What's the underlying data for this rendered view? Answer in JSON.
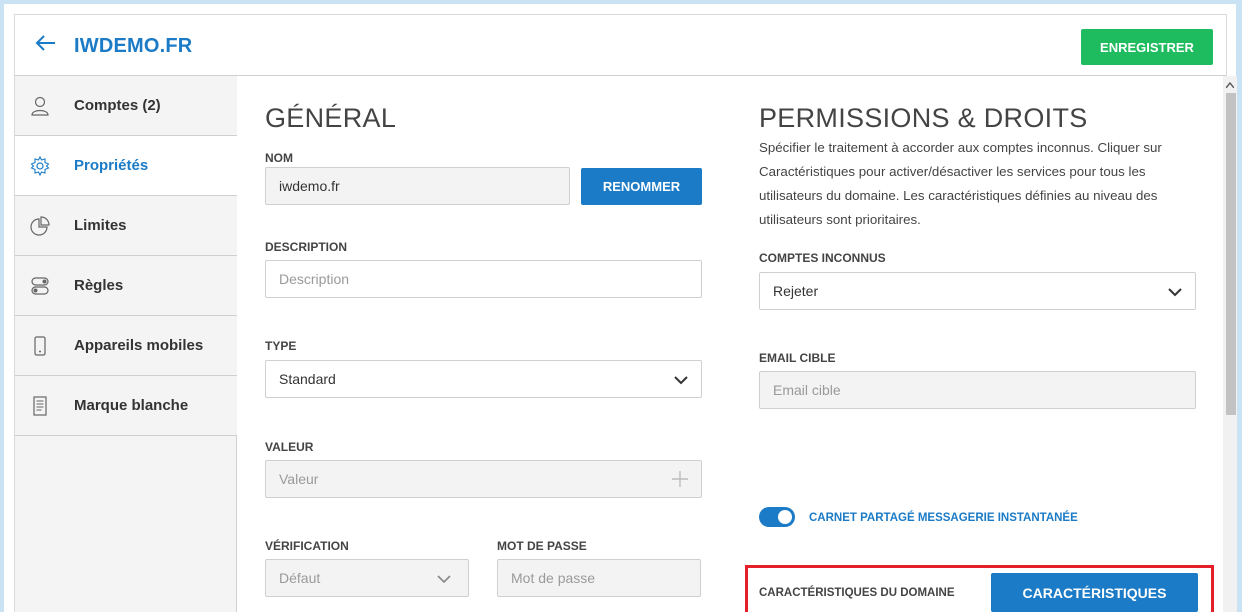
{
  "header": {
    "back_icon": "arrow-left-icon",
    "title": "IWDEMO.FR",
    "save_label": "ENREGISTRER"
  },
  "sidebar": {
    "items": [
      {
        "label": "Comptes (2)",
        "icon": "user-icon",
        "active": false
      },
      {
        "label": "Propriétés",
        "icon": "gear-icon",
        "active": true
      },
      {
        "label": "Limites",
        "icon": "pie-chart-icon",
        "active": false
      },
      {
        "label": "Règles",
        "icon": "toggles-icon",
        "active": false
      },
      {
        "label": "Appareils mobiles",
        "icon": "mobile-icon",
        "active": false
      },
      {
        "label": "Marque blanche",
        "icon": "document-icon",
        "active": false
      }
    ]
  },
  "general": {
    "heading": "GÉNÉRAL",
    "name_label": "NOM",
    "name_value": "iwdemo.fr",
    "rename_label": "RENOMMER",
    "description_label": "DESCRIPTION",
    "description_placeholder": "Description",
    "type_label": "TYPE",
    "type_value": "Standard",
    "value_label": "VALEUR",
    "value_placeholder": "Valeur",
    "verification_label": "VÉRIFICATION",
    "verification_value": "Défaut",
    "password_label": "MOT DE PASSE",
    "password_placeholder": "Mot de passe"
  },
  "permissions": {
    "heading": "PERMISSIONS & DROITS",
    "description": "Spécifier le traitement à accorder aux comptes inconnus. Cliquer sur Caractéristiques pour activer/désactiver les services pour tous les utilisateurs du domaine. Les caractéristiques définies au niveau des utilisateurs sont prioritaires.",
    "unknown_accounts_label": "COMPTES INCONNUS",
    "unknown_accounts_value": "Rejeter",
    "target_email_label": "EMAIL CIBLE",
    "target_email_placeholder": "Email cible",
    "shared_book_label": "CARNET PARTAGÉ MESSAGERIE INSTANTANÉE",
    "shared_book_enabled": true,
    "domain_features_label": "CARACTÉRISTIQUES DU DOMAINE",
    "features_button_label": "CARACTÉRISTIQUES"
  },
  "colors": {
    "accent": "#1b7bc6",
    "save": "#1ebc5f",
    "highlight": "#e41f2a"
  }
}
